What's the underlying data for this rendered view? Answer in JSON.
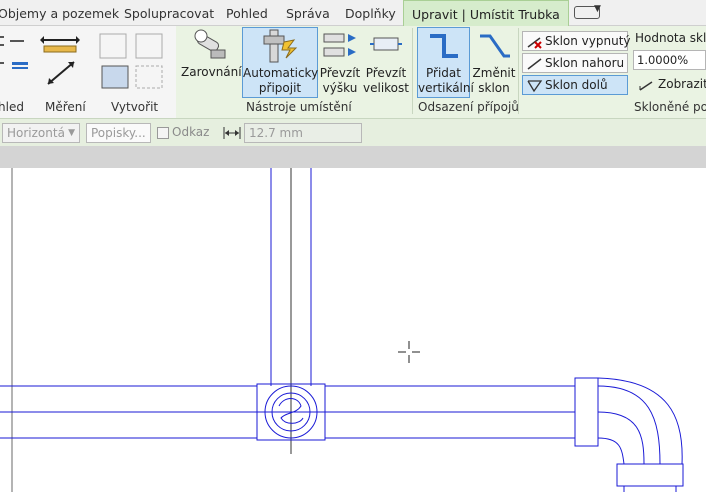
{
  "tabs": [
    {
      "label": "Objemy a pozemek"
    },
    {
      "label": "Spolupracovat"
    },
    {
      "label": "Pohled"
    },
    {
      "label": "Správa"
    },
    {
      "label": "Doplňky"
    },
    {
      "label": "Upravit | Umístit Trubka"
    }
  ],
  "ribbon": {
    "panels": {
      "view": "hled",
      "measure": "Měření",
      "create": "Vytvořit",
      "placement_tools": "Nástroje umístění",
      "offset_connections": "Odsazení přípojů",
      "sloped_pipe": "Skloněné pot"
    },
    "buttons": {
      "align": "Zarovnání",
      "auto_connect": "Automaticky připojit",
      "inherit_elevation": "Převzít výšku",
      "inherit_size": "Převzít velikost",
      "add_vertical": "Přidat vertikální",
      "change_slope": "Změnit sklon"
    },
    "slope": {
      "off": "Sklon vypnutý",
      "up": "Sklon nahoru",
      "down": "Sklon dolů",
      "value_label": "Hodnota sklo",
      "value": "1.0000%",
      "show": "Zobrazit"
    }
  },
  "options_bar": {
    "justification": "Horizontá",
    "tag_field": "Popisky...",
    "leader_label": "Odkaz",
    "length_value": "12.7 mm"
  },
  "colors": {
    "context_tab": "#d6eccc",
    "ribbon_context": "#eaf3e3",
    "active_button": "#cde4f7",
    "pipe_lines": "#1a1ad6"
  },
  "icons": [
    "align-icon",
    "auto-connect-icon",
    "inherit-elevation-icon",
    "inherit-size-icon",
    "add-vertical-icon",
    "change-slope-icon",
    "slope-off-icon",
    "slope-up-icon",
    "slope-down-icon",
    "show-icon",
    "length-icon",
    "crosshair-cursor-icon"
  ]
}
